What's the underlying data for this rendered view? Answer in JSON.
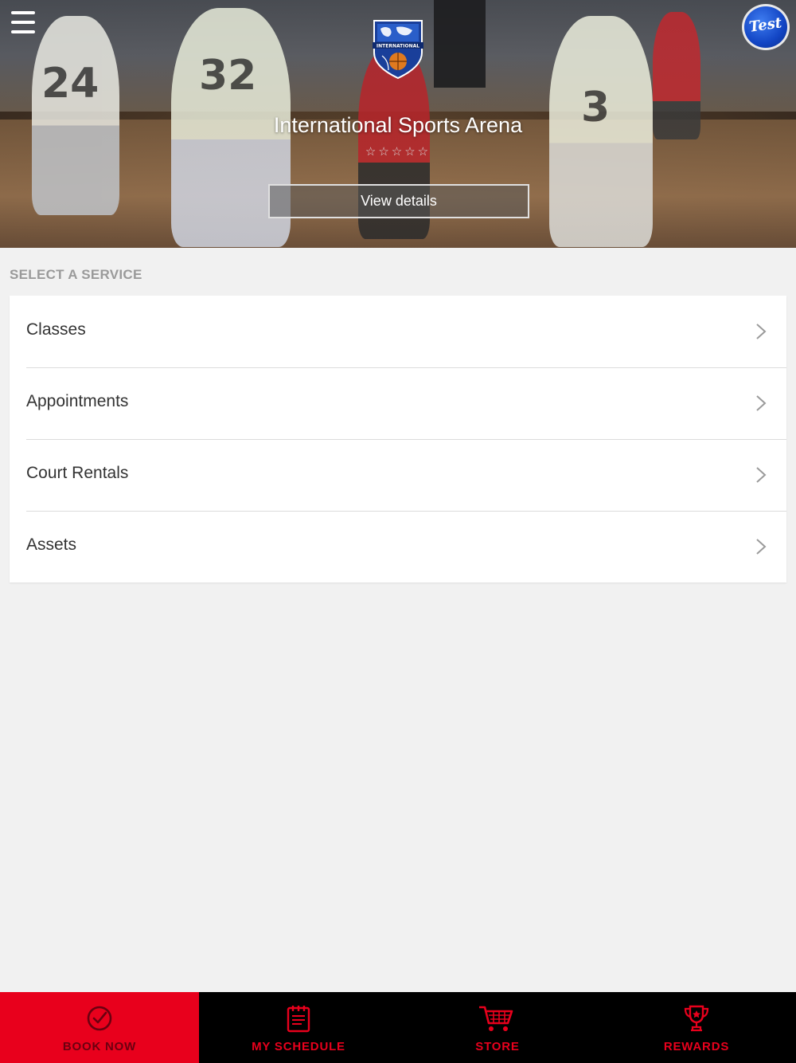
{
  "header": {
    "venue_name": "International Sports Arena",
    "rating_stars": "☆☆☆☆☆",
    "view_details_label": "View details",
    "avatar_text": "Test",
    "logo_text": "INTERNATIONAL"
  },
  "services": {
    "section_label": "SELECT A SERVICE",
    "items": [
      {
        "label": "Classes"
      },
      {
        "label": "Appointments"
      },
      {
        "label": "Court Rentals"
      },
      {
        "label": "Assets"
      }
    ]
  },
  "bottom_nav": {
    "items": [
      {
        "label": "BOOK NOW",
        "icon": "check-circle-icon",
        "active": true
      },
      {
        "label": "MY SCHEDULE",
        "icon": "calendar-icon",
        "active": false
      },
      {
        "label": "STORE",
        "icon": "cart-icon",
        "active": false
      },
      {
        "label": "REWARDS",
        "icon": "trophy-icon",
        "active": false
      }
    ]
  },
  "colors": {
    "accent": "#e8001c",
    "nav_background": "#000000",
    "page_background": "#f1f1f1"
  }
}
